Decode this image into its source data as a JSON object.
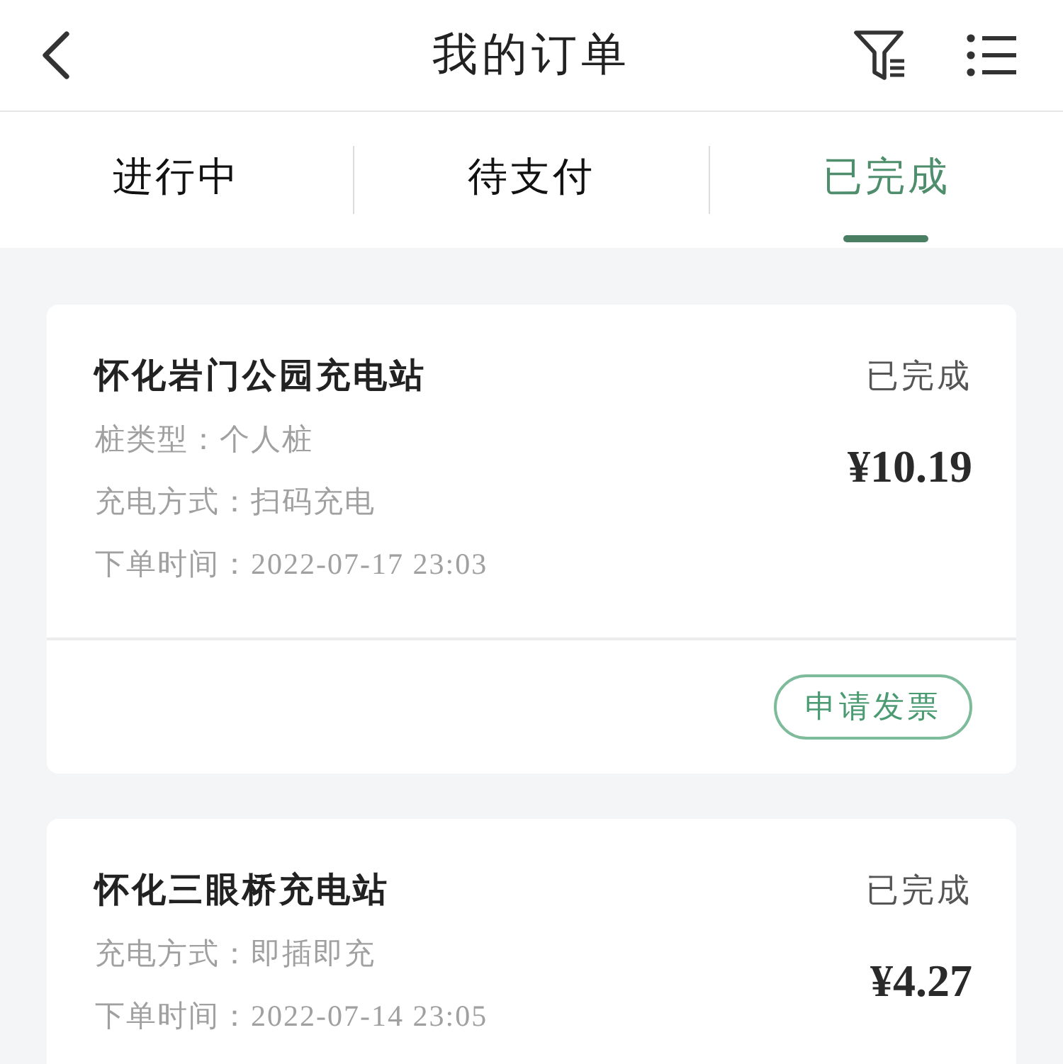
{
  "header": {
    "title": "我的订单"
  },
  "tabs": [
    {
      "label": "进行中",
      "selected": false
    },
    {
      "label": "待支付",
      "selected": false
    },
    {
      "label": "已完成",
      "selected": true
    }
  ],
  "orders": [
    {
      "station": "怀化岩门公园充电站",
      "status": "已完成",
      "price": "¥10.19",
      "details": [
        "桩类型：个人桩",
        "充电方式：扫码充电",
        "下单时间：2022-07-17 23:03"
      ],
      "actions": [
        "申请发票"
      ]
    },
    {
      "station": "怀化三眼桥充电站",
      "status": "已完成",
      "price": "¥4.27",
      "details": [
        "充电方式：即插即充",
        "下单时间：2022-07-14 23:05"
      ]
    }
  ]
}
